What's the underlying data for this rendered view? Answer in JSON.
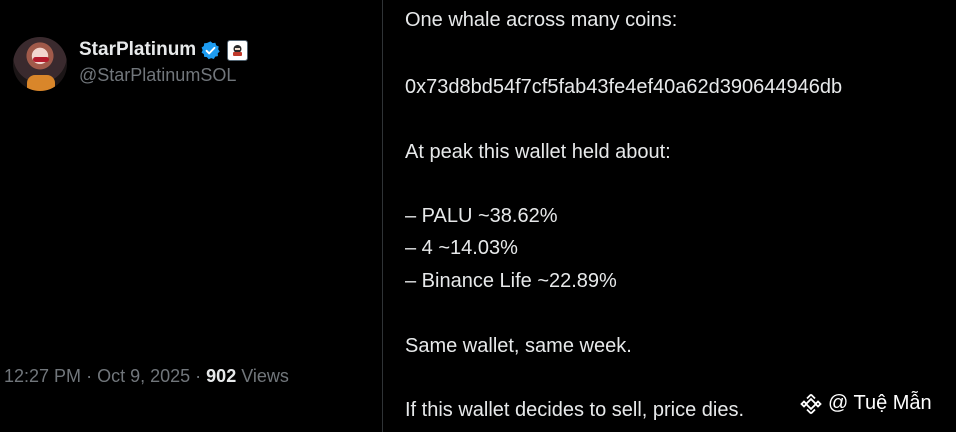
{
  "author": {
    "display_name": "StarPlatinum",
    "handle": "@StarPlatinumSOL"
  },
  "tweet": {
    "lines": [
      "One whale across many coins:",
      "0x73d8bd54f7cf5fab43fe4ef40a62d390644946db",
      "At peak this wallet held about:",
      "– PALU ~38.62%",
      "– 4 ~14.03%",
      "– Binance Life ~22.89%",
      "Same wallet, same week.",
      "If this wallet decides to sell, price dies."
    ]
  },
  "meta": {
    "time": "12:27 PM",
    "sep1": "·",
    "date": "Oct 9, 2025",
    "sep2": "·",
    "views_count": "902",
    "views_label": "Views"
  },
  "watermark": {
    "text": "@ Tuệ Mẫn"
  },
  "colors": {
    "background": "#000000",
    "text_primary": "#e7e9ea",
    "text_secondary": "#71767b",
    "verified_blue": "#1d9bf0",
    "divider": "#2f3336"
  },
  "icons": {
    "verified": "verified-badge-icon",
    "affiliate": "affiliate-badge-icon",
    "watermark": "binance-logo-icon"
  }
}
